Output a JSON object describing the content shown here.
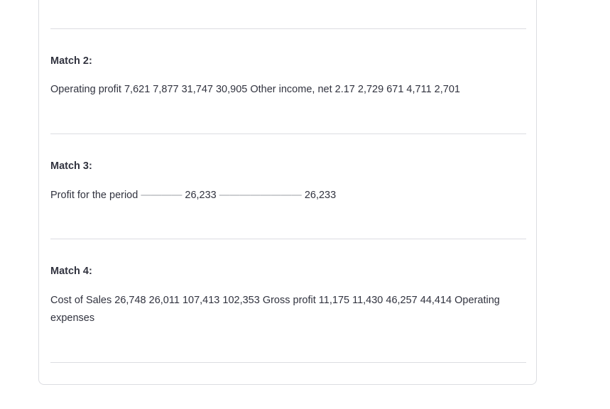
{
  "matches": [
    {
      "heading": "Match 2:",
      "text": "Operating profit 7,621 7,877 31,747 30,905 Other income, net 2.17 2,729 671 4,711 2,701"
    },
    {
      "heading": "Match 3:",
      "text_parts": {
        "label": "Profit for the period",
        "dash1": "————",
        "value1": "26,233",
        "dash2": "————————",
        "value2": "26,233"
      }
    },
    {
      "heading": "Match 4:",
      "text": "Cost of Sales 26,748 26,011 107,413 102,353 Gross profit 11,175 11,430 46,257 44,414 Operating expenses"
    }
  ],
  "colors": {
    "text": "#31333f",
    "border": "#dcdde2",
    "dash": "#9a9ca3"
  }
}
